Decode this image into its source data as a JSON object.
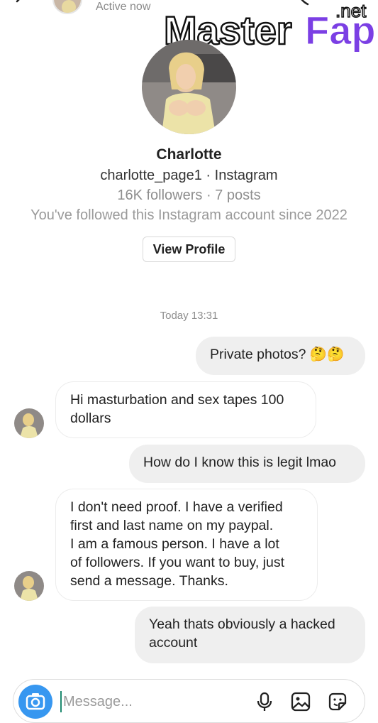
{
  "header": {
    "status": "Active now",
    "watermark": "MasterFap",
    "watermark_suffix": ".net"
  },
  "profile": {
    "name": "Charlotte",
    "handle": "charlotte_page1 · Instagram",
    "stats": "16K followers · 7 posts",
    "since": "You've followed this Instagram account since 2022",
    "view_button": "View Profile"
  },
  "timestamp": "Today 13:31",
  "messages": [
    {
      "dir": "out",
      "text": "Private photos? 🤔🤔"
    },
    {
      "dir": "in",
      "text": "Hi masturbation and sex tapes 100\ndollars"
    },
    {
      "dir": "out",
      "text": "How do I know this is legit lmao"
    },
    {
      "dir": "in",
      "text": "I don't need proof. I have a verified\nfirst and last name on my paypal.\nI am a famous person. I have a lot\nof followers. If you want to buy, just\nsend a message. Thanks."
    },
    {
      "dir": "out",
      "text": "Yeah thats obviously a hacked\naccount"
    }
  ],
  "composer": {
    "placeholder": "Message...",
    "icons": [
      "camera-icon",
      "microphone-icon",
      "gallery-icon",
      "sticker-icon"
    ],
    "accent": "#3797f0"
  }
}
